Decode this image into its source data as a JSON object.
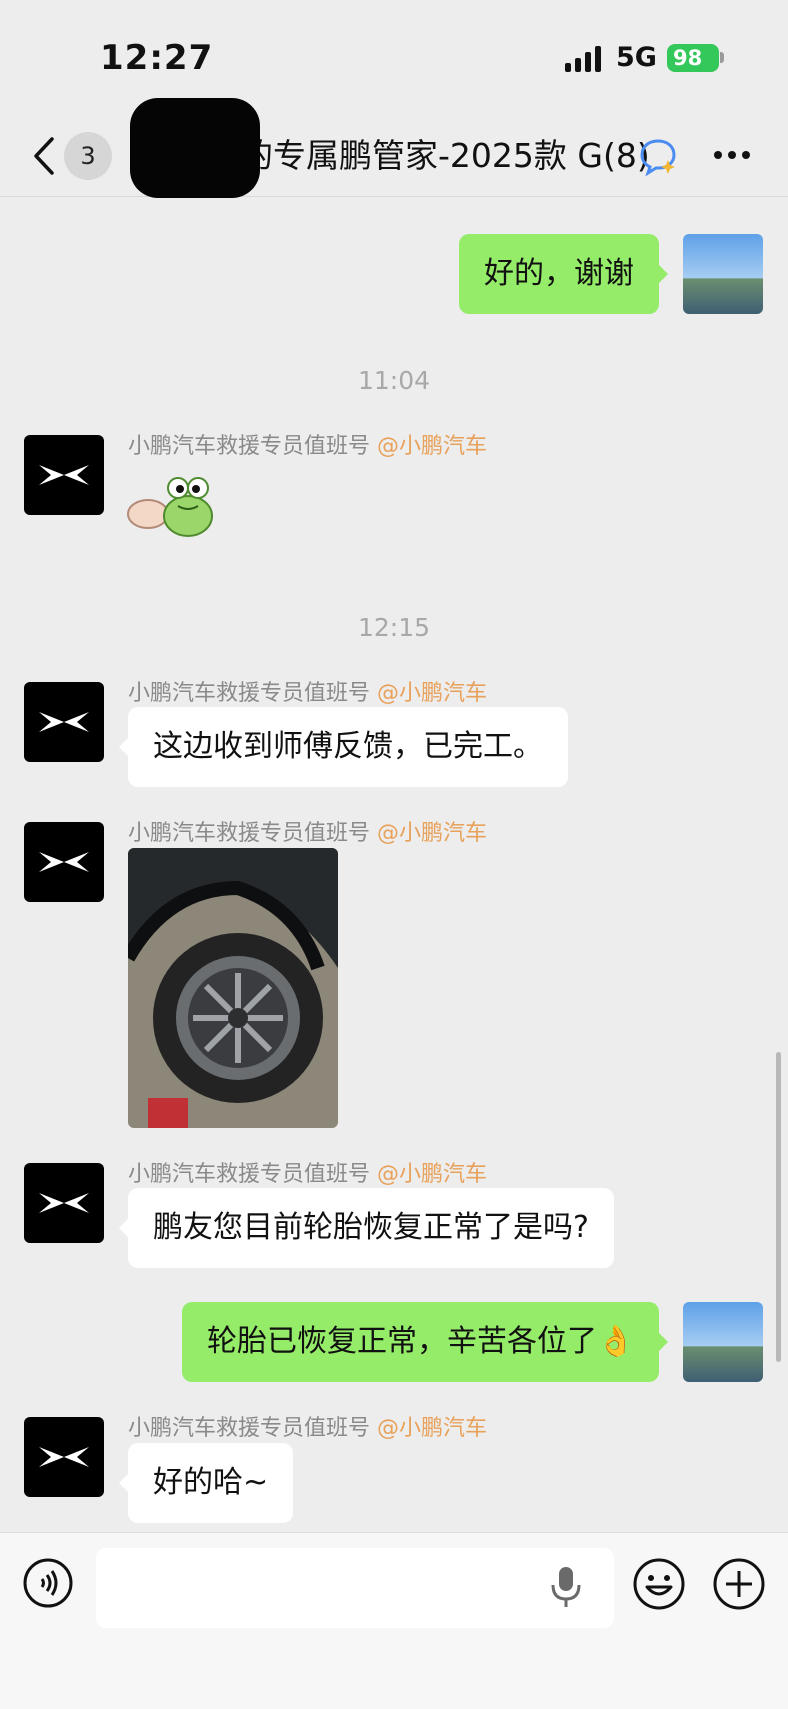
{
  "status_bar": {
    "time": "12:27",
    "network": "5G",
    "battery": "98"
  },
  "header": {
    "unread_count": "3",
    "title": "的专属鹏管家-2025款 G",
    "member_count": "(8)"
  },
  "messages": [
    {
      "type": "text",
      "from": "me",
      "text": "好的，谢谢"
    },
    {
      "type": "time",
      "text": "11:04"
    },
    {
      "type": "sticker",
      "sender": "小鹏汽车救援专员值班号",
      "org": "@小鹏汽车",
      "icon": "frog-sticker"
    },
    {
      "type": "time",
      "text": "12:15"
    },
    {
      "type": "text",
      "sender": "小鹏汽车救援专员值班号",
      "org": "@小鹏汽车",
      "text": "这边收到师傅反馈，已完工。"
    },
    {
      "type": "image",
      "sender": "小鹏汽车救援专员值班号",
      "org": "@小鹏汽车",
      "icon": "tire-photo"
    },
    {
      "type": "text",
      "sender": "小鹏汽车救援专员值班号",
      "org": "@小鹏汽车",
      "text": "鹏友您目前轮胎恢复正常了是吗?"
    },
    {
      "type": "text",
      "from": "me",
      "text": "轮胎已恢复正常，辛苦各位了👌"
    },
    {
      "type": "text",
      "sender": "小鹏汽车救援专员值班号",
      "org": "@小鹏汽车",
      "text": "好的哈~"
    }
  ],
  "input": {
    "placeholder": ""
  },
  "colors": {
    "my_bubble": "#95ec69",
    "org_tag": "#e8a15a",
    "background": "#ededed"
  }
}
